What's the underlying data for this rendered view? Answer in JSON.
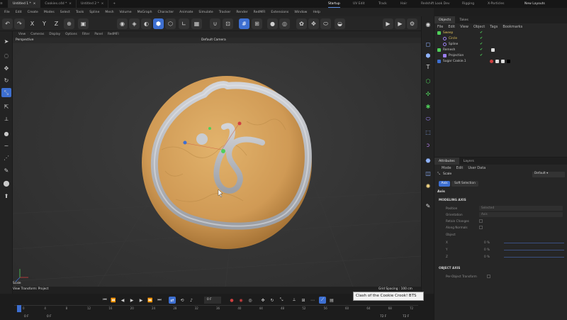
{
  "window_tabs": [
    "Untitled 1 *",
    "Cookies.c4d *",
    "Untitled 2 *"
  ],
  "layouts": [
    "Startup",
    "UV Edit",
    "Track",
    "Hair",
    "Redshift Look Dev",
    "Rigging",
    "X-Particles"
  ],
  "layouts_active": "Startup",
  "new_layouts": "New Layouts",
  "menu": [
    "File",
    "Edit",
    "Create",
    "Modes",
    "Select",
    "Tools",
    "Spline",
    "Mesh",
    "Volume",
    "MoGraph",
    "Character",
    "Animate",
    "Simulate",
    "Tracker",
    "Render",
    "RedMFI",
    "Extensions",
    "Window",
    "Help"
  ],
  "toolbar": {
    "x_label": "X",
    "y_label": "Y",
    "z_label": "Z"
  },
  "viewport_menu": [
    "View",
    "Cameras",
    "Display",
    "Options",
    "Filter",
    "Panel",
    "RedMFI"
  ],
  "viewport": {
    "name": "Perspective",
    "camera": "Default Camera",
    "grid_spacing": "Grid Spacing : 100 cm",
    "scale_label": "Scale",
    "view_transform": "View Transform: Project"
  },
  "tooltip": "Clash of the Cookie Crook! BTS",
  "timeline": {
    "current_frame": "0 F",
    "frame_field": "0 F",
    "fps_field": "72 F",
    "end_frame": "72 F",
    "ticks": [
      "0",
      "4",
      "8",
      "12",
      "16",
      "20",
      "24",
      "28",
      "32",
      "36",
      "40",
      "44",
      "48",
      "52",
      "56",
      "60",
      "64",
      "68",
      "72"
    ]
  },
  "objects_panel": {
    "tabs": [
      "Objects",
      "Takes"
    ],
    "menu": [
      "File",
      "Edit",
      "View",
      "Object",
      "Tags",
      "Bookmarks"
    ],
    "items": [
      {
        "name": "Sweep",
        "color": "#e3c25a"
      },
      {
        "name": "Circle",
        "color": "#e3c25a"
      },
      {
        "name": "Spline",
        "color": "#d0d0d0"
      },
      {
        "name": "Remesh",
        "color": "#d0d0d0"
      },
      {
        "name": "Projection",
        "color": "#d0d0d0"
      },
      {
        "name": "Sugar Cookie.1",
        "color": "#d0d0d0"
      }
    ]
  },
  "attributes_panel": {
    "tabs": [
      "Attributes",
      "Layers"
    ],
    "menu": [
      "Mode",
      "Edit",
      "User Data"
    ],
    "tool_name": "Scale",
    "dropdown": "Default",
    "sub_tabs": [
      "Axis",
      "Soft Selection"
    ],
    "section_title": "Axis",
    "modeling_axis": "MODELING AXIS",
    "position_label": "Position",
    "position_value": "Selected",
    "orientation_label": "Orientation",
    "orientation_value": "Axis",
    "retain_changes": "Retain Changes",
    "along_normals": "Along Normals",
    "object_label": "Object",
    "x_label": "X",
    "y_label": "Y",
    "z_label": "Z",
    "x_value": "0 %",
    "y_value": "0 %",
    "z_value": "0 %",
    "object_axis": "OBJECT AXIS",
    "per_object": "Per-Object Transform"
  },
  "colors": {
    "accent": "#3d6fd1",
    "cookie": "#d7a560",
    "icing": "#b9bcc2",
    "check": "#4fd05a"
  }
}
